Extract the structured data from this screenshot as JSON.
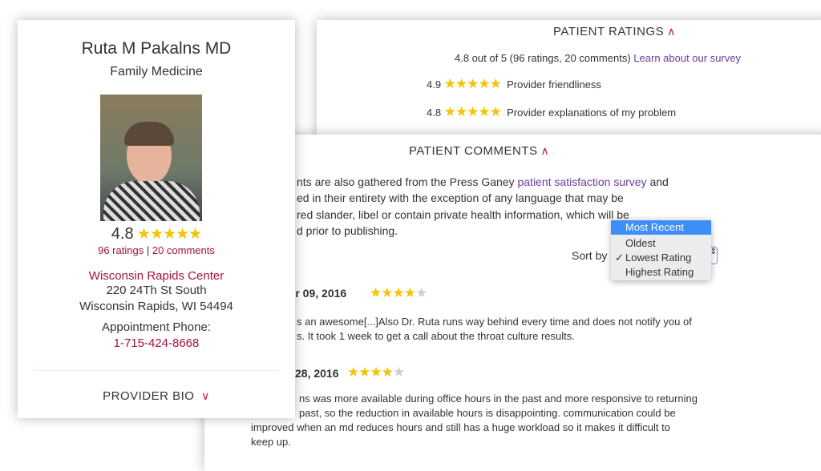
{
  "provider": {
    "name": "Ruta M Pakalns MD",
    "specialty": "Family Medicine",
    "rating": "4.8",
    "stars": "★★★★★",
    "ratings_link": "96 ratings",
    "separator": "|",
    "comments_link": "20 comments",
    "location_name": "Wisconsin Rapids Center",
    "address1": "220 24Th St South",
    "address2": "Wisconsin Rapids, WI 54494",
    "phone_label": "Appointment Phone:",
    "phone": "1-715-424-8668",
    "bio_label": "PROVIDER BIO",
    "bio_chevron": "∨"
  },
  "ratings": {
    "title": "PATIENT RATINGS",
    "chevron": "∧",
    "summary": "4.8 out of 5 (96 ratings, 20 comments)",
    "survey_link": "Learn about our survey",
    "items": [
      {
        "score": "4.9",
        "stars": "★★★★★",
        "label": "Provider friendliness"
      },
      {
        "score": "4.8",
        "stars": "★★★★★",
        "label": "Provider explanations of my problem"
      }
    ]
  },
  "comments": {
    "title": "PATIENT COMMENTS",
    "chevron": "∧",
    "intro": [
      "nts are also gathered from the Press Ganey ",
      "patient satisfaction survey",
      " and",
      "ed in their entirety with the exception of any language that may be",
      "red slander, libel or contain private health information, which will be",
      "d prior to publishing."
    ],
    "sort_label": "Sort by",
    "sort_options": [
      "Most Recent",
      "Oldest",
      "Lowest Rating",
      "Highest Rating"
    ],
    "sort_selected": "Lowest Rating",
    "list": [
      {
        "date": "ber 09, 2016",
        "stars": "★★★★",
        "empty": "★",
        "lines": [
          "s an awesome[...]Also Dr. Ruta runs way behind every time and does not notify you of",
          "s. It took 1 week to get a call about the throat culture results."
        ]
      },
      {
        "date": "28, 2016",
        "stars": "★★★★",
        "empty": "★",
        "lines": [
          "ns was more available during office hours in the past and more responsive to returning",
          "past, so the reduction in available hours is disappointing. communication could be",
          "improved when an md reduces hours and still has a huge workload so it makes it difficult to",
          "keep up."
        ]
      }
    ]
  },
  "colors": {
    "accent": "#a4123f",
    "link": "#6a3d9a",
    "star": "#f5c300",
    "menu_highlight": "#3d8ef7"
  }
}
